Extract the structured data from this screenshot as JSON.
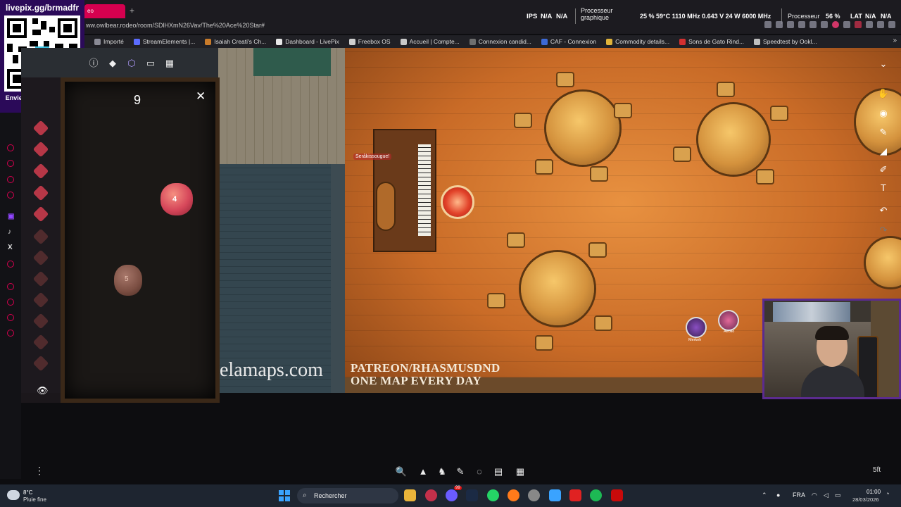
{
  "browser": {
    "active_tab_label": "eo",
    "new_tab_label": "+",
    "address": "ww.owlbear.rodeo/room/SDlHXmN26Vav/The%20Ace%20Star#"
  },
  "stats": {
    "ips_label": "IPS",
    "ips_1": "N/A",
    "ips_2": "N/A",
    "gpu_label_1": "Processeur",
    "gpu_label_2": "graphique",
    "gpu_values": "25 %  59°C  1110 MHz  0.643 V  24 W  6000 MHz",
    "cpu_label": "Processeur",
    "cpu_value": "56 %",
    "lat_label": "LAT",
    "lat_1": "N/A",
    "lat_2": "N/A"
  },
  "bookmarks": [
    {
      "label": "Importé",
      "color": "#8a8a95"
    },
    {
      "label": "StreamElements |...",
      "color": "#5b6cff"
    },
    {
      "label": "Isaiah Creati's Ch...",
      "color": "#c97b2a"
    },
    {
      "label": "Dashboard - LivePix",
      "color": "#e8e8e8"
    },
    {
      "label": "Freebox OS",
      "color": "#cfcfcf"
    },
    {
      "label": "Accueil | Compte...",
      "color": "#c9c9c9"
    },
    {
      "label": "Connexion candid...",
      "color": "#6f6f6f"
    },
    {
      "label": "CAF - Connexion",
      "color": "#3d6ad6"
    },
    {
      "label": "Commodity details...",
      "color": "#e0b33a"
    },
    {
      "label": "Sons de Gato Rind...",
      "color": "#d23030"
    },
    {
      "label": "Speedtest by Ookl...",
      "color": "#bfbfbf"
    }
  ],
  "bookmarks_more": "»",
  "qr": {
    "title": "livepix.gg/brmadfr",
    "caption": "Envie sua mensagem na live via pix!"
  },
  "obr_toolbar": {
    "info": "ⓘ",
    "fog": "◆",
    "dice": "⬡",
    "chat": "▭",
    "notes": "▦"
  },
  "dice_tray": {
    "total": "9",
    "close": "✕",
    "die1_face": "4",
    "die2_face": "5",
    "visibility": "👁"
  },
  "map": {
    "player_label": "Seråkissougue!",
    "token1_label": "Merkeh",
    "token2_label": "Aeolio",
    "watermark_left": "elamaps.com",
    "watermark_right_1": "PATREON/RHASMUSDND",
    "watermark_right_2": "ONE MAP EVERY DAY"
  },
  "map_controls": {
    "collapse": "⌄",
    "hand": "✋",
    "pointer": "◉",
    "pen": "✎",
    "measure": "◢",
    "brush": "✐",
    "text": "T",
    "undo": "↶",
    "redo": "↷"
  },
  "bottom_tools": {
    "zoom": "🔍",
    "pointer": "▲",
    "characters": "♞",
    "draw": "✎",
    "fog": "◌",
    "notes": "▤",
    "more": "▦"
  },
  "scale": "5ft",
  "more_menu": "⋮",
  "taskbar": {
    "weather_temp": "8°C",
    "weather_desc": "Pluie fine",
    "search_label": "Rechercher",
    "language": "FRA",
    "time": "01:00",
    "date": "28/03/2026",
    "chat_badge": "99"
  },
  "colors": {
    "twitch_purple": "#5b2b8f",
    "owlbear_pink": "#d6004f"
  }
}
